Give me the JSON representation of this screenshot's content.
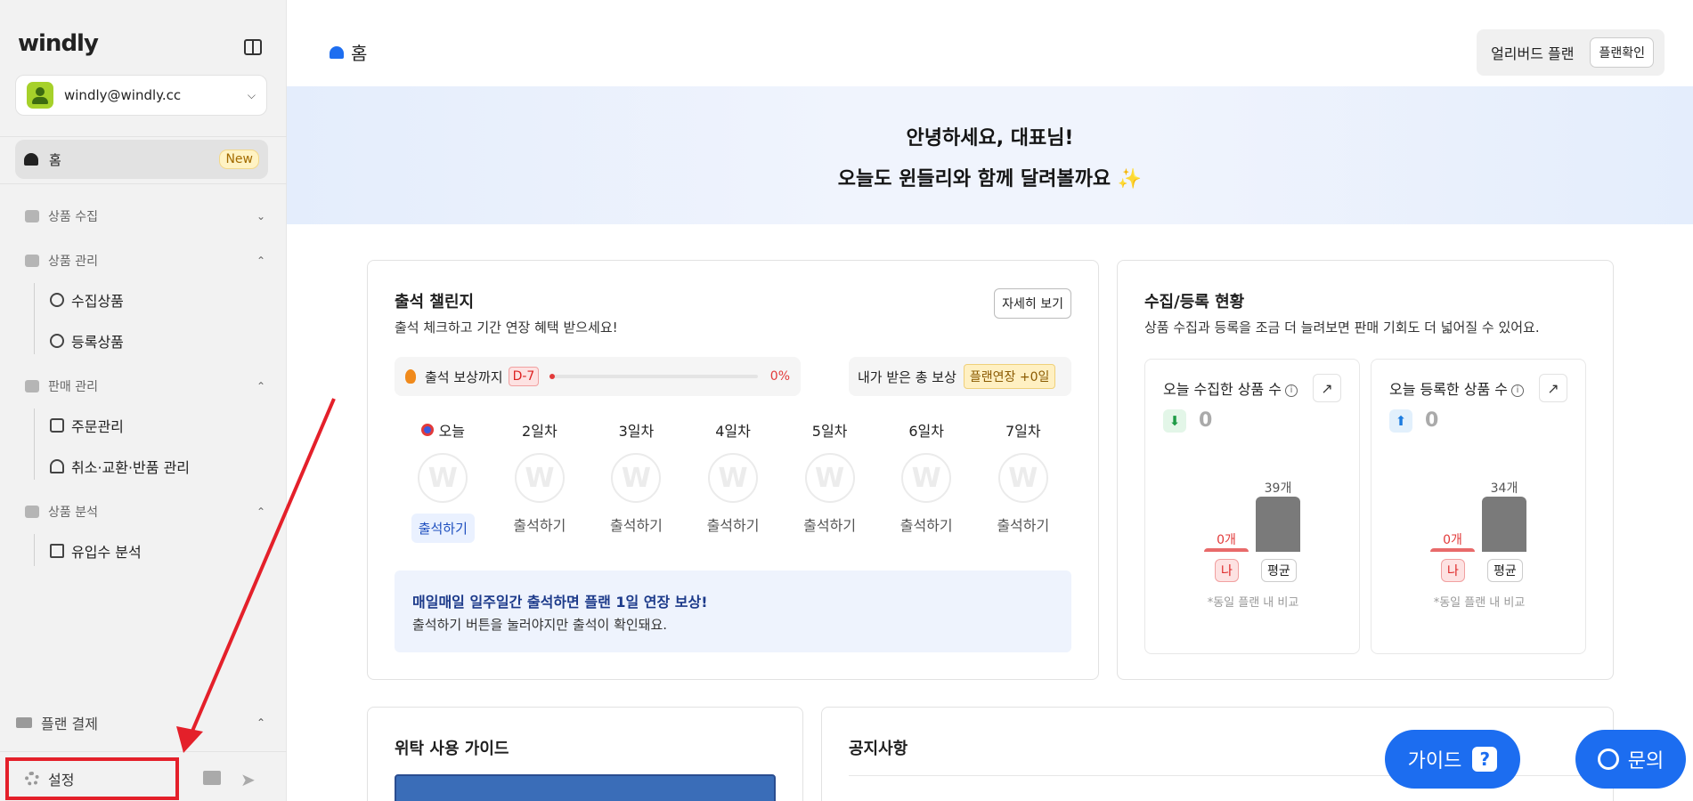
{
  "brand": {
    "logo": "windly"
  },
  "account": {
    "email": "windly@windly.cc"
  },
  "sidebar": {
    "home": {
      "label": "홈",
      "badge": "New"
    },
    "sections": [
      {
        "label": "상품 수집",
        "expanded": false,
        "items": []
      },
      {
        "label": "상품 관리",
        "expanded": true,
        "items": [
          {
            "label": "수집상품"
          },
          {
            "label": "등록상품"
          }
        ]
      },
      {
        "label": "판매 관리",
        "expanded": true,
        "items": [
          {
            "label": "주문관리"
          },
          {
            "label": "취소·교환·반품 관리"
          }
        ]
      },
      {
        "label": "상품 분석",
        "expanded": true,
        "items": [
          {
            "label": "유입수 분석"
          }
        ]
      }
    ],
    "plan_payment": "플랜 결제",
    "settings": "설정"
  },
  "header": {
    "title": "홈",
    "plan_name": "얼리버드 플랜",
    "plan_button": "플랜확인"
  },
  "hero": {
    "line1": "안녕하세요, 대표님!",
    "line2": "오늘도 윈들리와 함께 달려볼까요 ✨"
  },
  "attendance": {
    "title": "출석 챌린지",
    "subtitle": "출석 체크하고 기간 연장 혜택 받으세요!",
    "detail_button": "자세히 보기",
    "progress_label": "출석 보상까지",
    "d_day": "D-7",
    "progress_percent": "0%",
    "progress_value": 0,
    "reward_label": "내가 받은 총 보상",
    "reward_value": "플랜연장 +0일",
    "days": [
      {
        "label": "오늘",
        "button": "출석하기",
        "today": true
      },
      {
        "label": "2일차",
        "button": "출석하기"
      },
      {
        "label": "3일차",
        "button": "출석하기"
      },
      {
        "label": "4일차",
        "button": "출석하기"
      },
      {
        "label": "5일차",
        "button": "출석하기"
      },
      {
        "label": "6일차",
        "button": "출석하기"
      },
      {
        "label": "7일차",
        "button": "출석하기"
      }
    ],
    "info_title": "매일매일 일주일간 출석하면 플랜 1일 연장 보상!",
    "info_text": "출석하기 버튼을 눌러야지만 출석이 확인돼요."
  },
  "stats": {
    "title": "수집/등록 현황",
    "subtitle": "상품 수집과 등록을 조금 더 늘려보면 판매 기회도 더 넓어질 수 있어요.",
    "collected": {
      "title": "오늘 수집한 상품 수",
      "value": "0",
      "me_value": 0,
      "me_label": "0개",
      "avg_value": 39,
      "avg_label": "39개",
      "x_me": "나",
      "x_avg": "평균",
      "note": "*동일 플랜 내 비교"
    },
    "registered": {
      "title": "오늘 등록한 상품 수",
      "value": "0",
      "me_value": 0,
      "me_label": "0개",
      "avg_value": 34,
      "avg_label": "34개",
      "x_me": "나",
      "x_avg": "평균",
      "note": "*동일 플랜 내 비교"
    }
  },
  "guide": {
    "title": "위탁 사용 가이드"
  },
  "notice": {
    "title": "공지사항"
  },
  "fab": {
    "guide": "가이드",
    "contact": "문의"
  },
  "colors": {
    "accent": "#1c6df0",
    "annotation_red": "#e4202a"
  }
}
